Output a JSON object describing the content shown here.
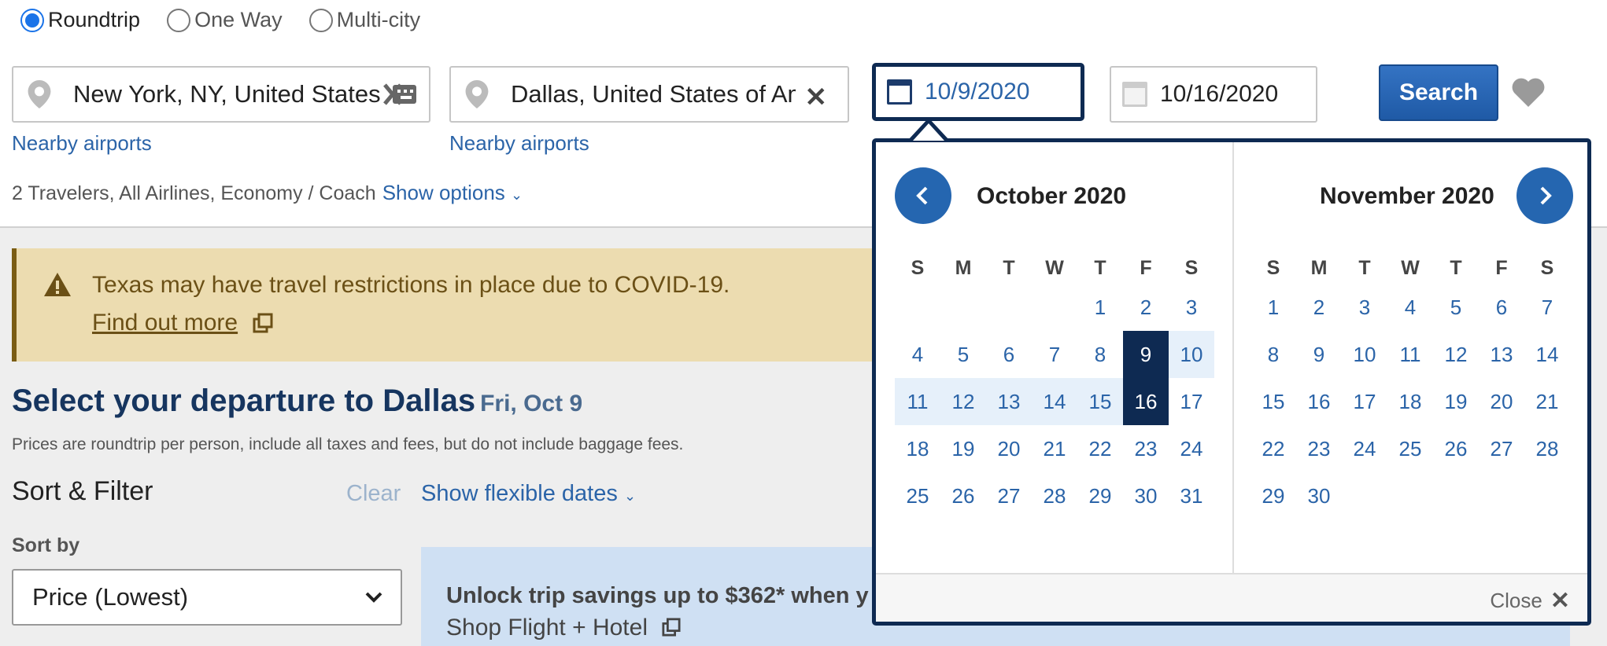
{
  "trip_types": [
    {
      "label": "Roundtrip",
      "checked": true
    },
    {
      "label": "One Way",
      "checked": false
    },
    {
      "label": "Multi-city",
      "checked": false
    }
  ],
  "origin": {
    "value": "New York, NY, United States"
  },
  "destination": {
    "value": "Dallas, United States of America"
  },
  "nearby_airports_label": "Nearby airports",
  "depart_date": "10/9/2020",
  "return_date": "10/16/2020",
  "search_label": "Search",
  "travelers_summary": "2 Travelers, All Airlines, Economy / Coach",
  "show_options_label": "Show options",
  "alert": {
    "message": "Texas may have travel restrictions in place due to COVID-19.",
    "link": "Find out more"
  },
  "heading": {
    "title": "Select your departure to Dallas",
    "date": "Fri, Oct 9"
  },
  "prices_note": "Prices are roundtrip per person, include all taxes and fees, but do not include baggage fees.",
  "sort_filter_label": "Sort & Filter",
  "clear_label": "Clear",
  "flexible_dates_label": "Show flexible dates",
  "sort_by_label": "Sort by",
  "sort_by_value": "Price (Lowest)",
  "promo": {
    "title": "Unlock trip savings up to $362* when y",
    "link": "Shop Flight + Hotel"
  },
  "calendar": {
    "weekdays": [
      "S",
      "M",
      "T",
      "W",
      "T",
      "F",
      "S"
    ],
    "close_label": "Close",
    "months": [
      {
        "title": "October 2020",
        "first_weekday": 4,
        "days": 31,
        "selected": [
          9,
          16
        ],
        "range": [
          10,
          15
        ]
      },
      {
        "title": "November 2020",
        "first_weekday": 0,
        "days": 30,
        "selected": [],
        "range": []
      }
    ]
  }
}
